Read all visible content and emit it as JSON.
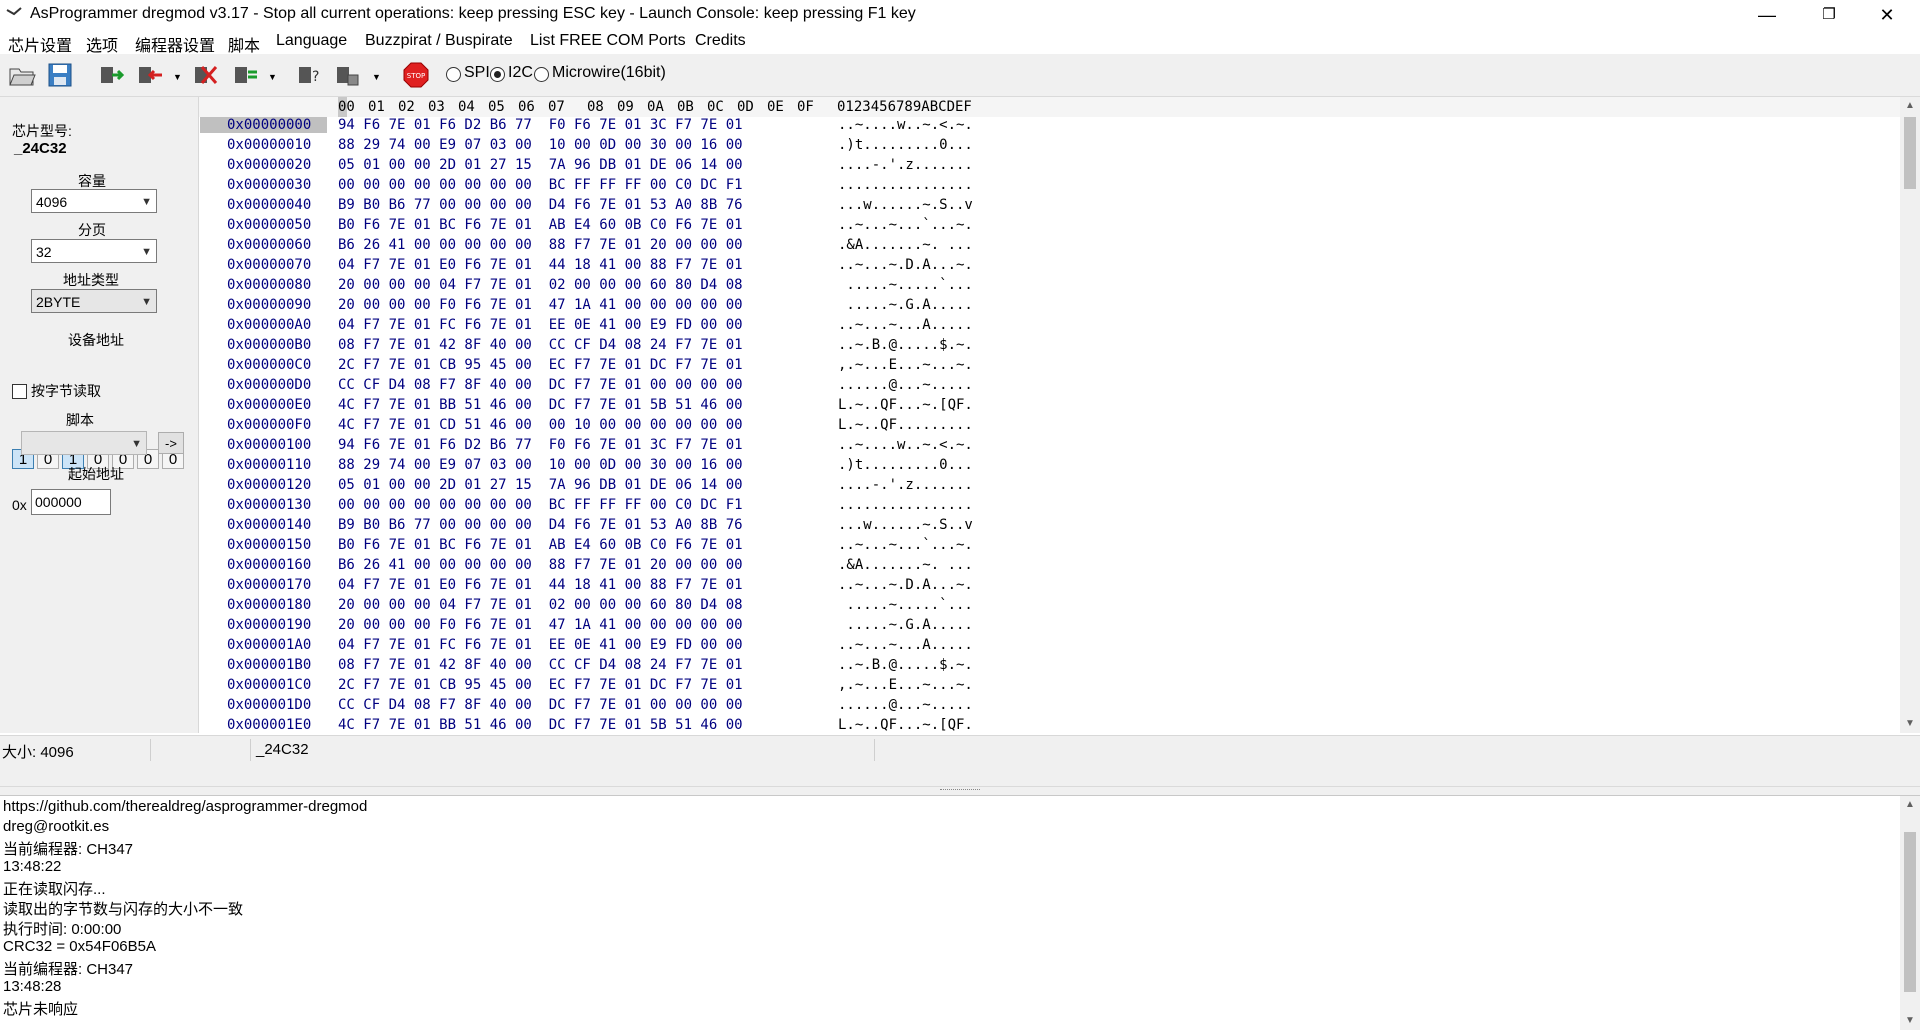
{
  "window": {
    "title": "AsProgrammer dregmod v3.17 - Stop all current operations: keep pressing ESC key - Launch Console: keep pressing F1 key",
    "minimize": "—",
    "restore": "❐",
    "close": "✕"
  },
  "menu": [
    "芯片设置",
    "选项",
    "编程器设置",
    "脚本",
    "Language",
    "Buzzpirat / Buspirate",
    "List FREE COM Ports",
    "Credits"
  ],
  "toolbar": {
    "icons": [
      "open-file-icon",
      "save-icon",
      "read-chip-icon",
      "write-chip-icon",
      "erase-chip-icon",
      "verify-icon",
      "chip-info-icon",
      "blank-check-icon",
      "stop-icon"
    ],
    "stop_label": "STOP",
    "protocols": [
      "SPI",
      "I2C",
      "Microwire(16bit)"
    ],
    "selected_protocol": "I2C"
  },
  "left": {
    "chip_model_label": "芯片型号:",
    "chip_model": "_24C32",
    "capacity_label": "容量",
    "capacity": "4096",
    "page_label": "分页",
    "page": "32",
    "addr_type_label": "地址类型",
    "addr_type": "2BYTE",
    "device_addr_label": "设备地址",
    "device_addr_bits": [
      "1",
      "0",
      "1",
      "0",
      "0",
      "0",
      "0"
    ],
    "device_addr_active": [
      true,
      false,
      true,
      false,
      false,
      false,
      false
    ],
    "read_by_byte_label": "按字节读取",
    "script_label": "脚本",
    "script_run_label": "->",
    "start_addr_label": "起始地址",
    "start_addr_prefix": "0x",
    "start_addr": "000000"
  },
  "hex": {
    "columns": [
      "00",
      "01",
      "02",
      "03",
      "04",
      "05",
      "06",
      "07",
      "08",
      "09",
      "0A",
      "0B",
      "0C",
      "0D",
      "0E",
      "0F"
    ],
    "ascii_header": "0123456789ABCDEF",
    "rows": [
      {
        "addr": "0x00000000",
        "bytes": "94 F6 7E 01 F6 D2 B6 77  F0 F6 7E 01 3C F7 7E 01",
        "ascii": "..~....w..~.<.~."
      },
      {
        "addr": "0x00000010",
        "bytes": "88 29 74 00 E9 07 03 00  10 00 0D 00 30 00 16 00",
        "ascii": ".)t.........0..."
      },
      {
        "addr": "0x00000020",
        "bytes": "05 01 00 00 2D 01 27 15  7A 96 DB 01 DE 06 14 00",
        "ascii": "....-.'.z......."
      },
      {
        "addr": "0x00000030",
        "bytes": "00 00 00 00 00 00 00 00  BC FF FF FF 00 C0 DC F1",
        "ascii": "................"
      },
      {
        "addr": "0x00000040",
        "bytes": "B9 B0 B6 77 00 00 00 00  D4 F6 7E 01 53 A0 8B 76",
        "ascii": "...w......~.S..v"
      },
      {
        "addr": "0x00000050",
        "bytes": "B0 F6 7E 01 BC F6 7E 01  AB E4 60 0B C0 F6 7E 01",
        "ascii": "..~...~...`...~."
      },
      {
        "addr": "0x00000060",
        "bytes": "B6 26 41 00 00 00 00 00  88 F7 7E 01 20 00 00 00",
        "ascii": ".&A.......~. ..."
      },
      {
        "addr": "0x00000070",
        "bytes": "04 F7 7E 01 E0 F6 7E 01  44 18 41 00 88 F7 7E 01",
        "ascii": "..~...~.D.A...~."
      },
      {
        "addr": "0x00000080",
        "bytes": "20 00 00 00 04 F7 7E 01  02 00 00 00 60 80 D4 08",
        "ascii": " .....~.....`..."
      },
      {
        "addr": "0x00000090",
        "bytes": "20 00 00 00 F0 F6 7E 01  47 1A 41 00 00 00 00 00",
        "ascii": " .....~.G.A....."
      },
      {
        "addr": "0x000000A0",
        "bytes": "04 F7 7E 01 FC F6 7E 01  EE 0E 41 00 E9 FD 00 00",
        "ascii": "..~...~...A....."
      },
      {
        "addr": "0x000000B0",
        "bytes": "08 F7 7E 01 42 8F 40 00  CC CF D4 08 24 F7 7E 01",
        "ascii": "..~.B.@.....$.~."
      },
      {
        "addr": "0x000000C0",
        "bytes": "2C F7 7E 01 CB 95 45 00  EC F7 7E 01 DC F7 7E 01",
        "ascii": ",.~...E...~...~."
      },
      {
        "addr": "0x000000D0",
        "bytes": "CC CF D4 08 F7 8F 40 00  DC F7 7E 01 00 00 00 00",
        "ascii": "......@...~....."
      },
      {
        "addr": "0x000000E0",
        "bytes": "4C F7 7E 01 BB 51 46 00  DC F7 7E 01 5B 51 46 00",
        "ascii": "L.~..QF...~.[QF."
      },
      {
        "addr": "0x000000F0",
        "bytes": "4C F7 7E 01 CD 51 46 00  00 10 00 00 00 00 00 00",
        "ascii": "L.~..QF........."
      },
      {
        "addr": "0x00000100",
        "bytes": "94 F6 7E 01 F6 D2 B6 77  F0 F6 7E 01 3C F7 7E 01",
        "ascii": "..~....w..~.<.~."
      },
      {
        "addr": "0x00000110",
        "bytes": "88 29 74 00 E9 07 03 00  10 00 0D 00 30 00 16 00",
        "ascii": ".)t.........0..."
      },
      {
        "addr": "0x00000120",
        "bytes": "05 01 00 00 2D 01 27 15  7A 96 DB 01 DE 06 14 00",
        "ascii": "....-.'.z......."
      },
      {
        "addr": "0x00000130",
        "bytes": "00 00 00 00 00 00 00 00  BC FF FF FF 00 C0 DC F1",
        "ascii": "................"
      },
      {
        "addr": "0x00000140",
        "bytes": "B9 B0 B6 77 00 00 00 00  D4 F6 7E 01 53 A0 8B 76",
        "ascii": "...w......~.S..v"
      },
      {
        "addr": "0x00000150",
        "bytes": "B0 F6 7E 01 BC F6 7E 01  AB E4 60 0B C0 F6 7E 01",
        "ascii": "..~...~...`...~."
      },
      {
        "addr": "0x00000160",
        "bytes": "B6 26 41 00 00 00 00 00  88 F7 7E 01 20 00 00 00",
        "ascii": ".&A.......~. ..."
      },
      {
        "addr": "0x00000170",
        "bytes": "04 F7 7E 01 E0 F6 7E 01  44 18 41 00 88 F7 7E 01",
        "ascii": "..~...~.D.A...~."
      },
      {
        "addr": "0x00000180",
        "bytes": "20 00 00 00 04 F7 7E 01  02 00 00 00 60 80 D4 08",
        "ascii": " .....~.....`..."
      },
      {
        "addr": "0x00000190",
        "bytes": "20 00 00 00 F0 F6 7E 01  47 1A 41 00 00 00 00 00",
        "ascii": " .....~.G.A....."
      },
      {
        "addr": "0x000001A0",
        "bytes": "04 F7 7E 01 FC F6 7E 01  EE 0E 41 00 E9 FD 00 00",
        "ascii": "..~...~...A....."
      },
      {
        "addr": "0x000001B0",
        "bytes": "08 F7 7E 01 42 8F 40 00  CC CF D4 08 24 F7 7E 01",
        "ascii": "..~.B.@.....$.~."
      },
      {
        "addr": "0x000001C0",
        "bytes": "2C F7 7E 01 CB 95 45 00  EC F7 7E 01 DC F7 7E 01",
        "ascii": ",.~...E...~...~."
      },
      {
        "addr": "0x000001D0",
        "bytes": "CC CF D4 08 F7 8F 40 00  DC F7 7E 01 00 00 00 00",
        "ascii": "......@...~....."
      },
      {
        "addr": "0x000001E0",
        "bytes": "4C F7 7E 01 BB 51 46 00  DC F7 7E 01 5B 51 46 00",
        "ascii": "L.~..QF...~.[QF."
      }
    ]
  },
  "status": {
    "size": "大小: 4096",
    "chip": "_24C32"
  },
  "console": {
    "lines": [
      "https://github.com/therealdreg/asprogrammer-dregmod",
      "dreg@rootkit.es",
      "当前编程器: CH347",
      "13:48:22",
      "正在读取闪存...",
      "读取出的字节数与闪存的大小不一致",
      "执行时间: 0:00:00",
      "CRC32 = 0x54F06B5A",
      "当前编程器: CH347",
      "13:48:28",
      "芯片未响应"
    ]
  }
}
